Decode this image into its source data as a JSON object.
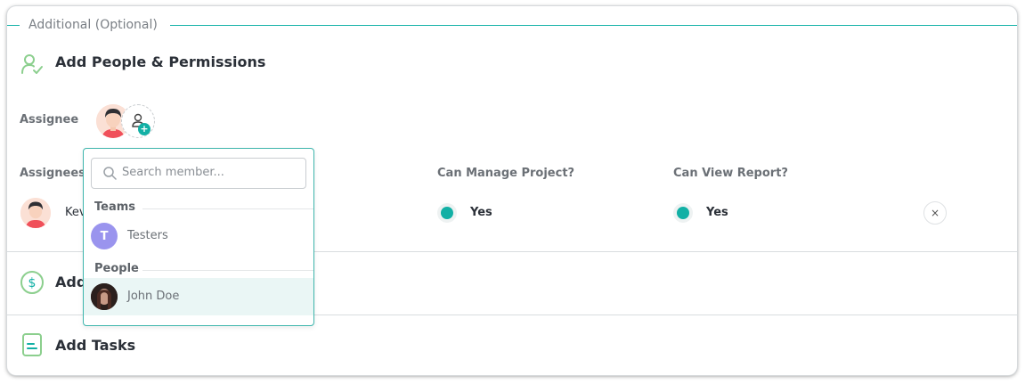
{
  "section": {
    "legend": "Additional (Optional)"
  },
  "people": {
    "title": "Add People & Permissions",
    "assignee_label": "Assignee",
    "columns": {
      "assignees": "Assignees",
      "manage_project": "Can Manage Project?",
      "view_report": "Can View Report?"
    },
    "row": {
      "name_visible": "Kev",
      "manage_value": "Yes",
      "view_value": "Yes",
      "remove_symbol": "×"
    }
  },
  "budget": {
    "title_visible": "Add"
  },
  "tasks": {
    "title": "Add Tasks"
  },
  "dropdown": {
    "search_placeholder": "Search member...",
    "teams_label": "Teams",
    "teams": [
      {
        "initial": "T",
        "name": "Testers"
      }
    ],
    "people_label": "People",
    "people": [
      {
        "name": "John Doe"
      }
    ]
  },
  "colors": {
    "accent": "#12b0a5",
    "team_avatar": "#9a94ee",
    "highlight": "#eaf6f5"
  }
}
